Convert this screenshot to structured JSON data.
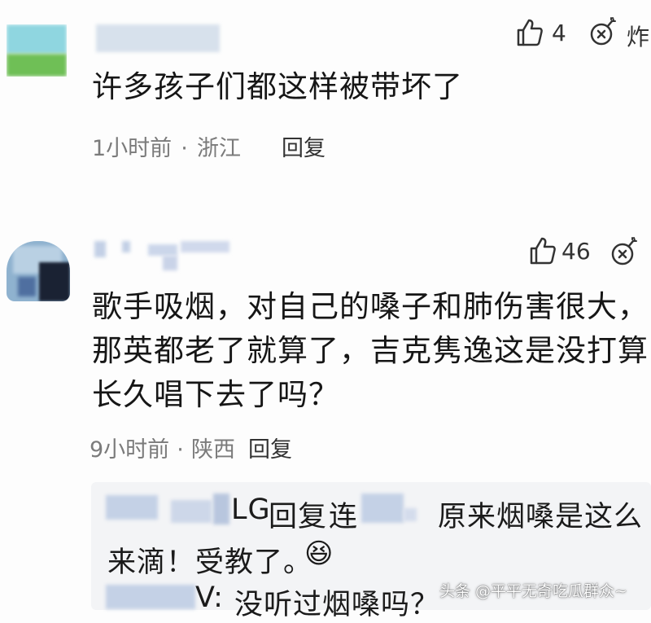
{
  "comments": [
    {
      "text_lines": [
        "许多孩子们都这样被带坏了"
      ],
      "time": "1小时前",
      "sep": "·",
      "location": "浙江",
      "reply_label": "回复",
      "likes": "4",
      "action_label": "炸"
    },
    {
      "text_lines": [
        "歌手吸烟，对自己的嗓子和肺伤害很大，",
        "那英都老了就算了，吉克隽逸这是没打算",
        "长久唱下去了吗？"
      ],
      "time": "9小时前",
      "sep": "·",
      "location": "陕西",
      "reply_label": "回复",
      "likes": "46",
      "replies": [
        {
          "author_visible": "LG",
          "reply_word": "回复",
          "target_visible": "连",
          "content": "原来烟嗓是这么"
        },
        {
          "content_cont": "来滴！受教了。",
          "emoji": "😆"
        },
        {
          "author_visible": "V:",
          "content": "没听过烟嗓吗？"
        }
      ]
    }
  ],
  "watermark": {
    "text": "头条 @平平无奇吃瓜群众~"
  },
  "colors": {
    "avatar1_top": "#8fd6e0",
    "avatar1_bottom": "#6fbf56",
    "avatar2_bg": "#8fb2cf",
    "reply_bg": "#f3f4f6",
    "meta_text": "#7b7b7b"
  },
  "icons": {
    "like": "thumbs-up-icon",
    "action": "bomb-icon"
  }
}
